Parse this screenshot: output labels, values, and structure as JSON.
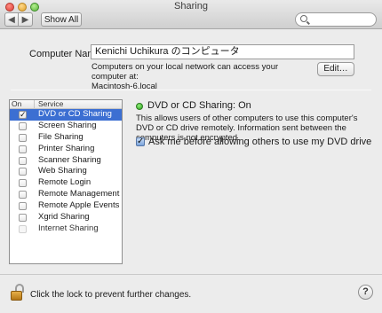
{
  "window": {
    "title": "Sharing"
  },
  "toolbar": {
    "back_glyph": "◀",
    "forward_glyph": "▶",
    "show_all_label": "Show All",
    "search_placeholder": ""
  },
  "computer": {
    "label": "Computer Name:",
    "value": "Kenichi Uchikura のコンピュータ",
    "note_line1": "Computers on your local network can access your computer at:",
    "note_line2": "Macintosh-6.local",
    "edit_label": "Edit…"
  },
  "services": {
    "header_on": "On",
    "header_service": "Service",
    "items": [
      {
        "label": "DVD or CD Sharing",
        "checked": true,
        "selected": true,
        "enabled": true
      },
      {
        "label": "Screen Sharing",
        "checked": false,
        "selected": false,
        "enabled": true
      },
      {
        "label": "File Sharing",
        "checked": false,
        "selected": false,
        "enabled": true
      },
      {
        "label": "Printer Sharing",
        "checked": false,
        "selected": false,
        "enabled": true
      },
      {
        "label": "Scanner Sharing",
        "checked": false,
        "selected": false,
        "enabled": true
      },
      {
        "label": "Web Sharing",
        "checked": false,
        "selected": false,
        "enabled": true
      },
      {
        "label": "Remote Login",
        "checked": false,
        "selected": false,
        "enabled": true
      },
      {
        "label": "Remote Management",
        "checked": false,
        "selected": false,
        "enabled": true
      },
      {
        "label": "Remote Apple Events",
        "checked": false,
        "selected": false,
        "enabled": true
      },
      {
        "label": "Xgrid Sharing",
        "checked": false,
        "selected": false,
        "enabled": true
      },
      {
        "label": "Internet Sharing",
        "checked": false,
        "selected": false,
        "enabled": false
      }
    ]
  },
  "detail": {
    "status": "DVD or CD Sharing: On",
    "status_color": "#2a9e1c",
    "description": "This allows users of other computers to use this computer's DVD or CD drive remotely. Information sent between the computers is not encrypted.",
    "ask_label": "Ask me before allowing others to use my DVD drive",
    "ask_checked": true
  },
  "footer": {
    "lock_text": "Click the lock to prevent further changes.",
    "help_label": "?"
  },
  "colors": {
    "selection": "#3c6fd2"
  }
}
